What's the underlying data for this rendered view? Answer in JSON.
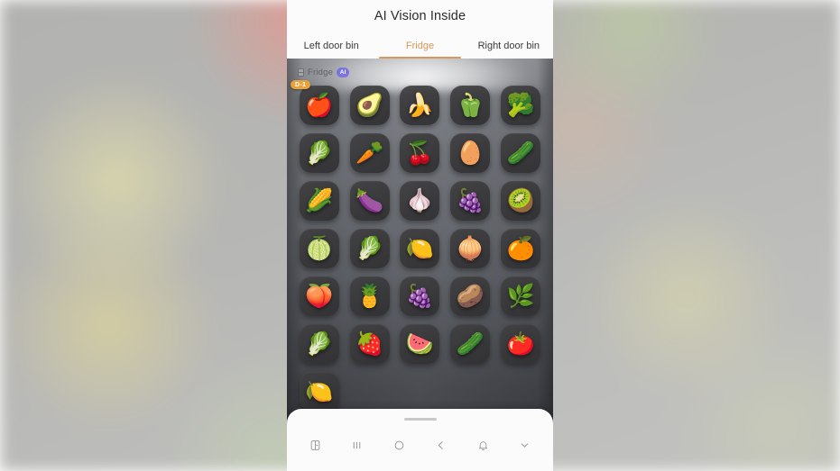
{
  "app": {
    "title": "AI Vision Inside"
  },
  "tabs": [
    {
      "label": "Left door bin",
      "active": false
    },
    {
      "label": "Fridge",
      "active": true
    },
    {
      "label": "Right door bin",
      "active": false
    }
  ],
  "compartment": {
    "icon": "fridge-shelf-icon",
    "name": "Fridge",
    "ai_badge": "AI"
  },
  "colors": {
    "accent": "#d9975a",
    "badge": "#e8a23c",
    "ai_badge_start": "#6b78e8",
    "ai_badge_end": "#8d6fe0",
    "title_text": "#2b2b2b",
    "tab_text": "#3a3a3a",
    "nav_icon": "#9a9a9a"
  },
  "items": [
    {
      "name": "apple",
      "glyph": "🍎",
      "badge": "D-1"
    },
    {
      "name": "avocado",
      "glyph": "🥑",
      "badge": null
    },
    {
      "name": "banana",
      "glyph": "🍌",
      "badge": null
    },
    {
      "name": "bell-pepper",
      "glyph": "🫑",
      "badge": null
    },
    {
      "name": "broccoli",
      "glyph": "🥦",
      "badge": null
    },
    {
      "name": "cabbage",
      "glyph": "🥬",
      "badge": null
    },
    {
      "name": "carrot",
      "glyph": "🥕",
      "badge": null
    },
    {
      "name": "cherries",
      "glyph": "🍒",
      "badge": null
    },
    {
      "name": "eggs",
      "glyph": "🥚",
      "badge": null
    },
    {
      "name": "cucumber",
      "glyph": "🥒",
      "badge": null
    },
    {
      "name": "corn",
      "glyph": "🌽",
      "badge": null
    },
    {
      "name": "eggplant",
      "glyph": "🍆",
      "badge": null
    },
    {
      "name": "garlic",
      "glyph": "🧄",
      "badge": null
    },
    {
      "name": "grapes",
      "glyph": "🍇",
      "badge": null
    },
    {
      "name": "kiwi",
      "glyph": "🥝",
      "badge": null
    },
    {
      "name": "melon",
      "glyph": "🍈",
      "badge": null
    },
    {
      "name": "lettuce",
      "glyph": "🥬",
      "badge": null
    },
    {
      "name": "squash",
      "glyph": "🍋",
      "badge": null
    },
    {
      "name": "onion",
      "glyph": "🧅",
      "badge": null
    },
    {
      "name": "persimmon",
      "glyph": "🍊",
      "badge": null
    },
    {
      "name": "peach",
      "glyph": "🍑",
      "badge": null
    },
    {
      "name": "pineapple",
      "glyph": "🍍",
      "badge": null
    },
    {
      "name": "plum",
      "glyph": "🍇",
      "badge": null
    },
    {
      "name": "potato",
      "glyph": "🥔",
      "badge": null
    },
    {
      "name": "green-onion",
      "glyph": "🌿",
      "badge": null
    },
    {
      "name": "spinach",
      "glyph": "🥬",
      "badge": null
    },
    {
      "name": "strawberry",
      "glyph": "🍓",
      "badge": null
    },
    {
      "name": "watermelon",
      "glyph": "🍉",
      "badge": null
    },
    {
      "name": "zucchini",
      "glyph": "🥒",
      "badge": null
    },
    {
      "name": "tomato",
      "glyph": "🍅",
      "badge": null
    },
    {
      "name": "lemon",
      "glyph": "🍋",
      "badge": null
    }
  ],
  "navbar": {
    "buttons": [
      {
        "name": "screenshot-capture-icon"
      },
      {
        "name": "recents-icon"
      },
      {
        "name": "home-icon"
      },
      {
        "name": "back-icon"
      },
      {
        "name": "notifications-bell-icon"
      },
      {
        "name": "collapse-chevron-down-icon"
      }
    ]
  }
}
